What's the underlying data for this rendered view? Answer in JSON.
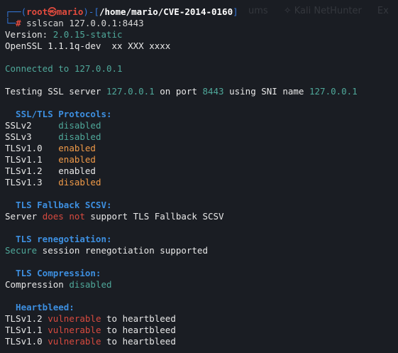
{
  "background_tabs": {
    "item1": "ums",
    "item2_icon": "dragon-icon",
    "item2": "Kali NetHunter",
    "item3": "Ex"
  },
  "prompt": {
    "open": "┌──(",
    "user": "root",
    "at": "㉿",
    "host": "mario",
    "sep": ")-[",
    "path": "/home/mario/CVE-2014-0160",
    "close": "]",
    "second": "└─",
    "hash": "#",
    "command": " sslscan 127.0.0.1:8443"
  },
  "version": {
    "label": "Version: ",
    "value": "2.0.15-static"
  },
  "openssl": "OpenSSL 1.1.1q-dev  xx XXX xxxx",
  "connected": "Connected to 127.0.0.1",
  "testing": {
    "prefix": "Testing SSL server ",
    "host": "127.0.0.1",
    "mid": " on port ",
    "port": "8443",
    "mid2": " using SNI name ",
    "sni": "127.0.0.1"
  },
  "protocols": {
    "heading": "  SSL/TLS Protocols:",
    "rows": [
      {
        "name": "SSLv2     ",
        "status": "disabled",
        "color": "#4fa89a"
      },
      {
        "name": "SSLv3     ",
        "status": "disabled",
        "color": "#4fa89a"
      },
      {
        "name": "TLSv1.0   ",
        "status": "enabled",
        "color": "#f09a48"
      },
      {
        "name": "TLSv1.1   ",
        "status": "enabled",
        "color": "#f09a48"
      },
      {
        "name": "TLSv1.2   ",
        "status": "enabled",
        "color": "#e8e8e8"
      },
      {
        "name": "TLSv1.3   ",
        "status": "disabled",
        "color": "#f09a48"
      }
    ]
  },
  "fallback": {
    "heading": "  TLS Fallback SCSV:",
    "pre": "Server ",
    "neg": "does not",
    "post": " support TLS Fallback SCSV"
  },
  "renegotiation": {
    "heading": "  TLS renegotiation:",
    "secure": "Secure",
    "rest": " session renegotiation supported"
  },
  "compression": {
    "heading": "  TLS Compression:",
    "pre": "Compression ",
    "value": "disabled"
  },
  "heartbleed": {
    "heading": "  Heartbleed:",
    "rows": [
      {
        "ver": "TLSv1.2 ",
        "status": "vulnerable",
        "post": " to heartbleed"
      },
      {
        "ver": "TLSv1.1 ",
        "status": "vulnerable",
        "post": " to heartbleed"
      },
      {
        "ver": "TLSv1.0 ",
        "status": "vulnerable",
        "post": " to heartbleed"
      }
    ]
  }
}
